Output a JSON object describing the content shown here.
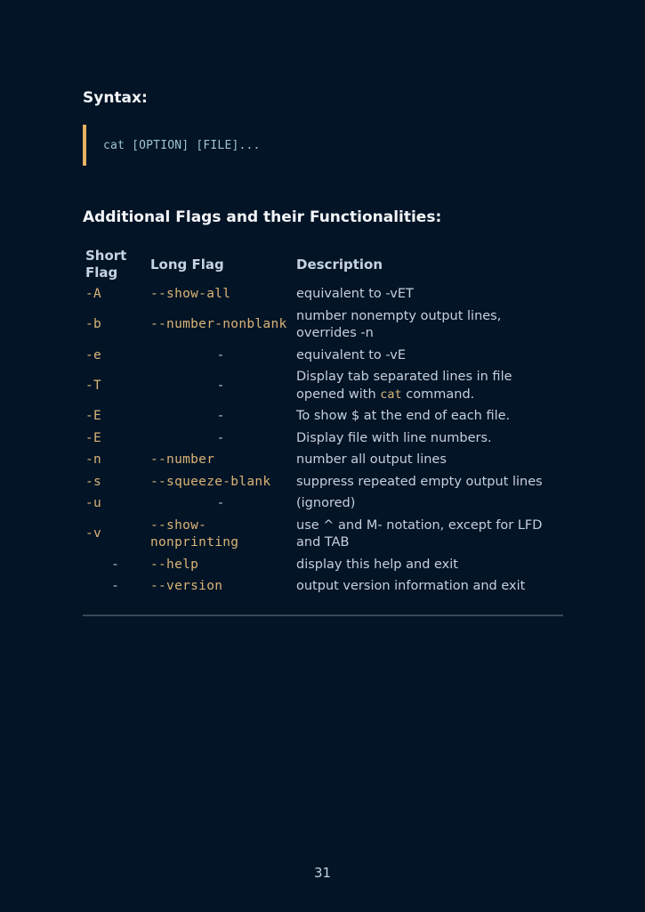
{
  "syntax": {
    "heading": "Syntax:",
    "code": "cat [OPTION] [FILE]..."
  },
  "flags_section": {
    "heading": "Additional Flags and their Functionalities:",
    "columns": {
      "short_line1": "Short",
      "short_line2": "Flag",
      "long": "Long Flag",
      "description": "Description"
    },
    "rows": [
      {
        "short": "-A",
        "long": "--show-all",
        "description": "equivalent to -vET"
      },
      {
        "short": "-b",
        "long": "--number-nonblank",
        "description": "number nonempty output lines, overrides -n"
      },
      {
        "short": "-e",
        "long": "-",
        "description": "equivalent to -vE"
      },
      {
        "short": "-T",
        "long": "-",
        "description_before": "Display tab separated lines in file opened with ",
        "description_code": "cat",
        "description_after": " command."
      },
      {
        "short": "-E",
        "long": "-",
        "description": "To show $ at the end of each file."
      },
      {
        "short": "-E",
        "long": "-",
        "description": "Display file with line numbers."
      },
      {
        "short": "-n",
        "long": "--number",
        "description": "number all output lines"
      },
      {
        "short": "-s",
        "long": "--squeeze-blank",
        "description": "suppress repeated empty output lines"
      },
      {
        "short": "-u",
        "long": "-",
        "description": "(ignored)"
      },
      {
        "short": "-v",
        "long": "--show-nonprinting",
        "description": "use ^ and M- notation, except for LFD and TAB"
      },
      {
        "short": "-",
        "long": "--help",
        "description": "display this help and exit"
      },
      {
        "short": "-",
        "long": "--version",
        "description": "output version information and exit"
      }
    ]
  },
  "footer": {
    "page_number": "31"
  },
  "colors": {
    "background": "#021426",
    "accent_bar": "#e6b261",
    "flag_text": "#dbb476",
    "code_text": "#9fc3d2",
    "body_text": "#c6cfdc",
    "heading_text": "#f3f5f8"
  }
}
